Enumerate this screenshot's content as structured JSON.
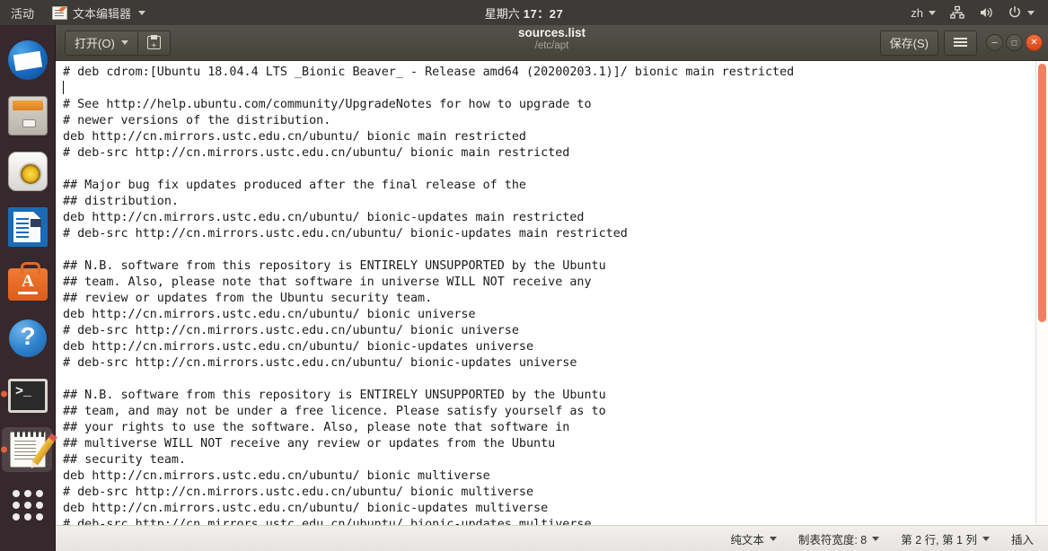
{
  "topbar": {
    "activities": "活动",
    "app_icon": "text-editor-icon",
    "app_name": "文本编辑器",
    "clock_day": "星期六",
    "clock_time": "17：27",
    "input_source": "zh",
    "icons": [
      "network-icon",
      "volume-icon",
      "power-icon"
    ]
  },
  "dock": {
    "items": [
      {
        "name": "thunderbird-mail",
        "running": false,
        "active": false
      },
      {
        "name": "files-nautilus",
        "running": false,
        "active": false
      },
      {
        "name": "rhythmbox-music",
        "running": false,
        "active": false
      },
      {
        "name": "libreoffice-writer",
        "running": false,
        "active": false
      },
      {
        "name": "ubuntu-software",
        "running": false,
        "active": false
      },
      {
        "name": "help",
        "running": false,
        "active": false
      },
      {
        "name": "terminal",
        "running": true,
        "active": false
      },
      {
        "name": "text-editor-gedit",
        "running": true,
        "active": true
      },
      {
        "name": "show-applications",
        "running": false,
        "active": false
      }
    ]
  },
  "window": {
    "header": {
      "open_label": "打开(O)",
      "new_tab_icon": "new-document-icon",
      "title": "sources.list",
      "subtitle": "/etc/apt",
      "save_label": "保存(S)",
      "menu_icon": "hamburger-menu-icon",
      "minimize_icon": "minimize-icon",
      "maximize_icon": "maximize-icon",
      "close_icon": "close-icon"
    },
    "document": {
      "lines": [
        "# deb cdrom:[Ubuntu 18.04.4 LTS _Bionic Beaver_ - Release amd64 (20200203.1)]/ bionic main restricted",
        "",
        "# See http://help.ubuntu.com/community/UpgradeNotes for how to upgrade to",
        "# newer versions of the distribution.",
        "deb http://cn.mirrors.ustc.edu.cn/ubuntu/ bionic main restricted",
        "# deb-src http://cn.mirrors.ustc.edu.cn/ubuntu/ bionic main restricted",
        "",
        "## Major bug fix updates produced after the final release of the",
        "## distribution.",
        "deb http://cn.mirrors.ustc.edu.cn/ubuntu/ bionic-updates main restricted",
        "# deb-src http://cn.mirrors.ustc.edu.cn/ubuntu/ bionic-updates main restricted",
        "",
        "## N.B. software from this repository is ENTIRELY UNSUPPORTED by the Ubuntu",
        "## team. Also, please note that software in universe WILL NOT receive any",
        "## review or updates from the Ubuntu security team.",
        "deb http://cn.mirrors.ustc.edu.cn/ubuntu/ bionic universe",
        "# deb-src http://cn.mirrors.ustc.edu.cn/ubuntu/ bionic universe",
        "deb http://cn.mirrors.ustc.edu.cn/ubuntu/ bionic-updates universe",
        "# deb-src http://cn.mirrors.ustc.edu.cn/ubuntu/ bionic-updates universe",
        "",
        "## N.B. software from this repository is ENTIRELY UNSUPPORTED by the Ubuntu",
        "## team, and may not be under a free licence. Please satisfy yourself as to",
        "## your rights to use the software. Also, please note that software in",
        "## multiverse WILL NOT receive any review or updates from the Ubuntu",
        "## security team.",
        "deb http://cn.mirrors.ustc.edu.cn/ubuntu/ bionic multiverse",
        "# deb-src http://cn.mirrors.ustc.edu.cn/ubuntu/ bionic multiverse",
        "deb http://cn.mirrors.ustc.edu.cn/ubuntu/ bionic-updates multiverse",
        "# deb-src http://cn.mirrors.ustc.edu.cn/ubuntu/ bionic-updates multiverse"
      ],
      "cursor_line_index": 1
    },
    "statusbar": {
      "language": "纯文本",
      "tab_width": "制表符宽度: 8",
      "position": "第 2 行, 第 1 列",
      "mode": "插入"
    },
    "scrollbar": {
      "orientation": "vertical",
      "thumb_color": "#f08060"
    }
  },
  "colors": {
    "topbar_bg": "#3c3b37",
    "dock_bg": "#36282c",
    "headerbar_bg": "#4b493f",
    "accent": "#e2623c",
    "editor_bg": "#ffffff",
    "editor_fg": "#1b1b1b",
    "statusbar_bg": "#ecebe7"
  }
}
